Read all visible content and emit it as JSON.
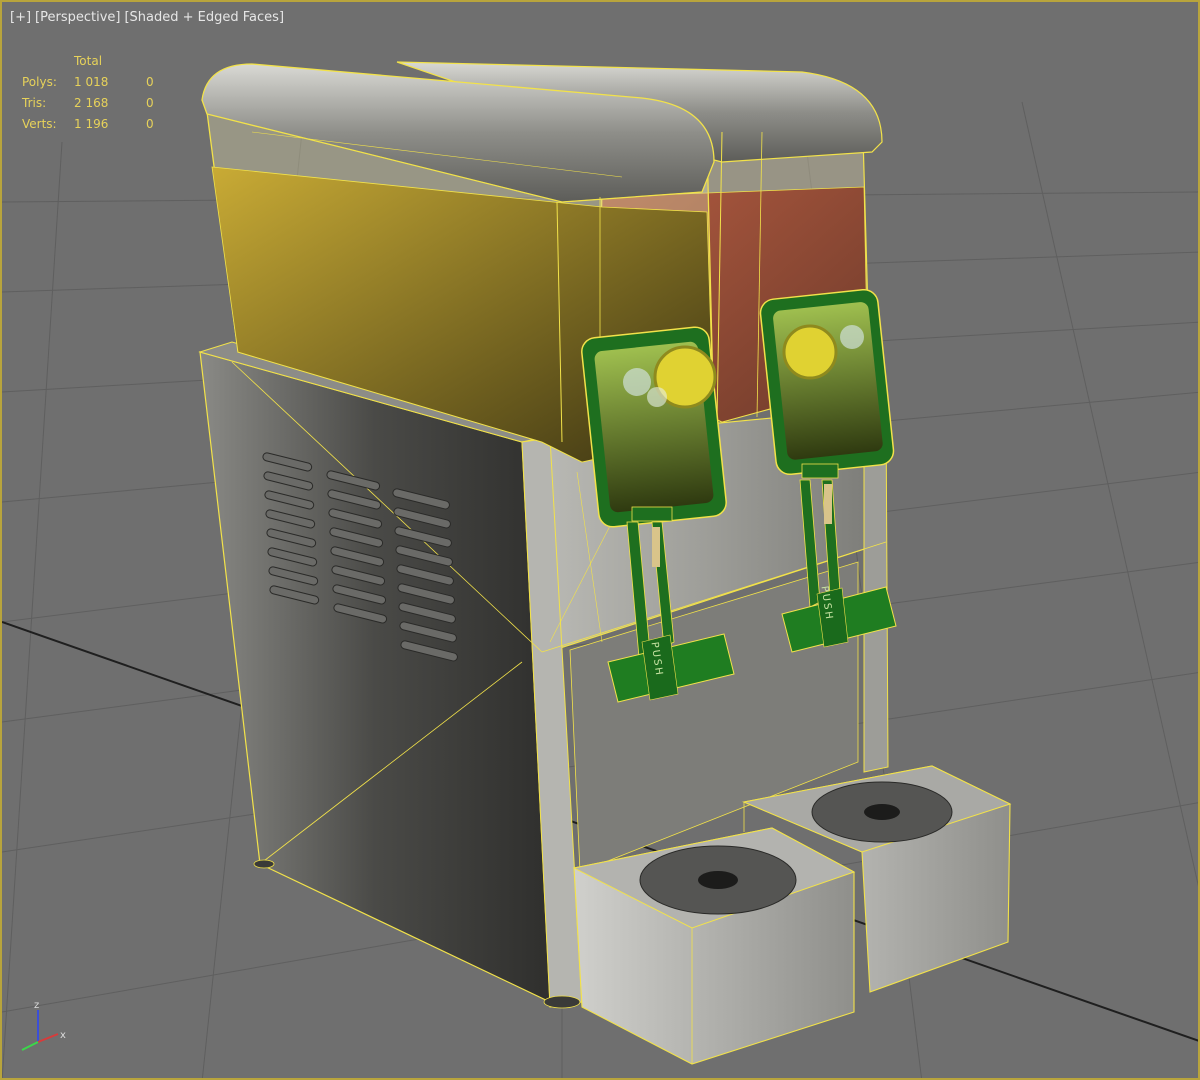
{
  "viewport": {
    "labels": [
      "[+]",
      "[Perspective]",
      "[Shaded + Edged Faces]"
    ]
  },
  "stats": {
    "header": "Total",
    "rows": [
      {
        "label": "Polys:",
        "total": "1 018",
        "selected": "0"
      },
      {
        "label": "Tris:",
        "total": "2 168",
        "selected": "0"
      },
      {
        "label": "Verts:",
        "total": "1 196",
        "selected": "0"
      }
    ]
  },
  "model": {
    "lever_text": "PUSH"
  },
  "axis": {
    "z": "z",
    "x": "x"
  },
  "colors": {
    "background": "#6f6f6f",
    "viewport_border": "#b8a43c",
    "stats_text": "#e7d25a",
    "wire": "#f2e24a",
    "green": "#1f7a22",
    "juice_left": "#b89a28",
    "juice_right": "#a24c36"
  }
}
